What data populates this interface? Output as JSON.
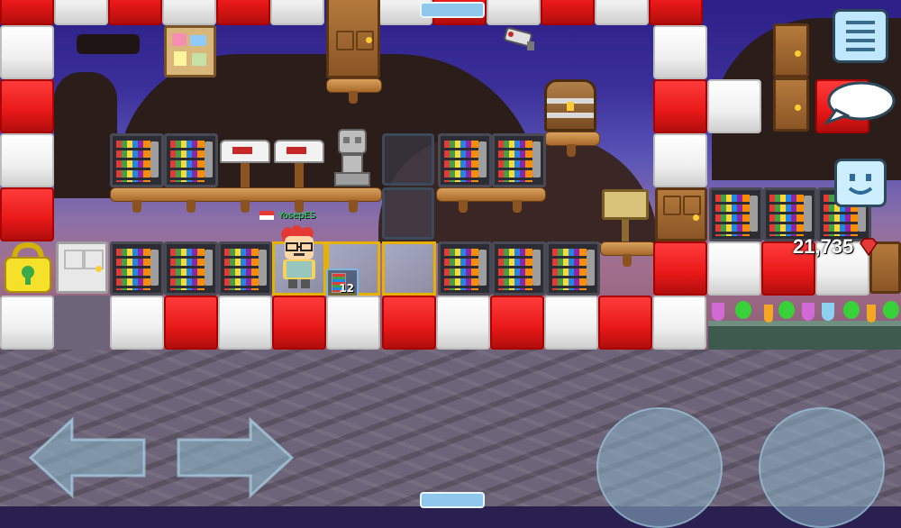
{
  "player": {
    "name": "YosepES",
    "flag": "indonesia-flag"
  },
  "hud": {
    "gems": "21,735",
    "gem_icon": "red-gem-icon",
    "menu_icon": "list-menu-icon",
    "chat_icon": "speech-bubble-icon",
    "emote_icon": "smiley-face-icon"
  },
  "held_item": {
    "count": "12",
    "icon": "vending-machine-icon"
  },
  "controls": {
    "left": "left-arrow-icon",
    "right": "right-arrow-icon",
    "jump": "jump-pad",
    "punch": "punch-pad"
  },
  "colors": {
    "block_red": "#e81818",
    "block_white": "#f0f0f0",
    "sky_top": "#2c1f86",
    "ground": "#6e6479",
    "name_green": "#22e24a"
  }
}
